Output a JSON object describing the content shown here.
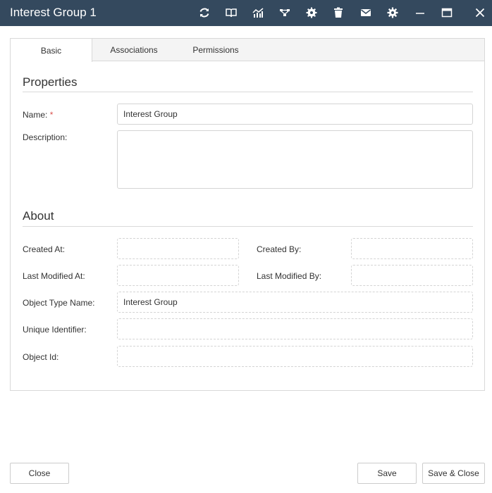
{
  "window": {
    "title": "Interest Group 1",
    "toolbar_icons": [
      "refresh-icon",
      "book-icon",
      "chart-icon",
      "workflow-icon",
      "settings-gear-icon",
      "trash-icon",
      "envelope-icon",
      "gear-icon",
      "minimize-icon",
      "maximize-icon",
      "close-icon"
    ]
  },
  "tabs": [
    {
      "label": "Basic",
      "active": true
    },
    {
      "label": "Associations",
      "active": false
    },
    {
      "label": "Permissions",
      "active": false
    }
  ],
  "properties": {
    "title": "Properties",
    "name_label": "Name:",
    "required_mark": "*",
    "name_value": "Interest Group",
    "description_label": "Description:",
    "description_value": ""
  },
  "about": {
    "title": "About",
    "created_at_label": "Created At:",
    "created_at_value": "",
    "created_by_label": "Created By:",
    "created_by_value": "",
    "last_modified_at_label": "Last Modified At:",
    "last_modified_at_value": "",
    "last_modified_by_label": "Last Modified By:",
    "last_modified_by_value": "",
    "object_type_name_label": "Object Type Name:",
    "object_type_name_value": "Interest Group",
    "unique_identifier_label": "Unique Identifier:",
    "unique_identifier_value": "",
    "object_id_label": "Object Id:",
    "object_id_value": ""
  },
  "footer": {
    "close_label": "Close",
    "save_label": "Save",
    "save_close_label": "Save & Close"
  },
  "colors": {
    "titlebar": "#34495e",
    "required": "#d9534f"
  }
}
